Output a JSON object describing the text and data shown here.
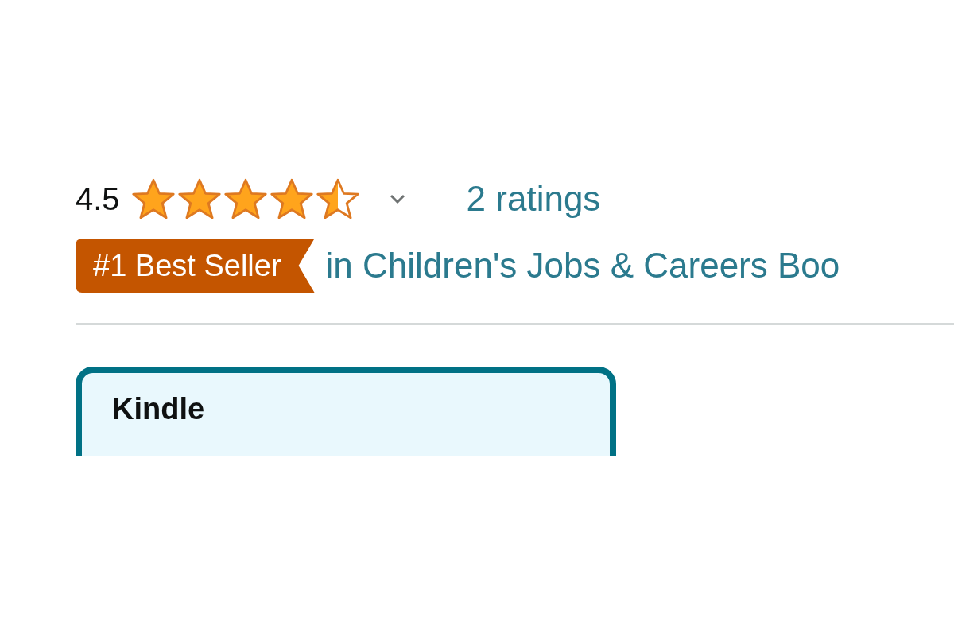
{
  "rating": {
    "value": "4.5",
    "stars": 4.5,
    "count": "2 ratings"
  },
  "best_seller": {
    "badge": "#1 Best Seller",
    "category": "in Children's Jobs & Careers Boo"
  },
  "format_card": {
    "title": "Kindle",
    "selected": true
  }
}
